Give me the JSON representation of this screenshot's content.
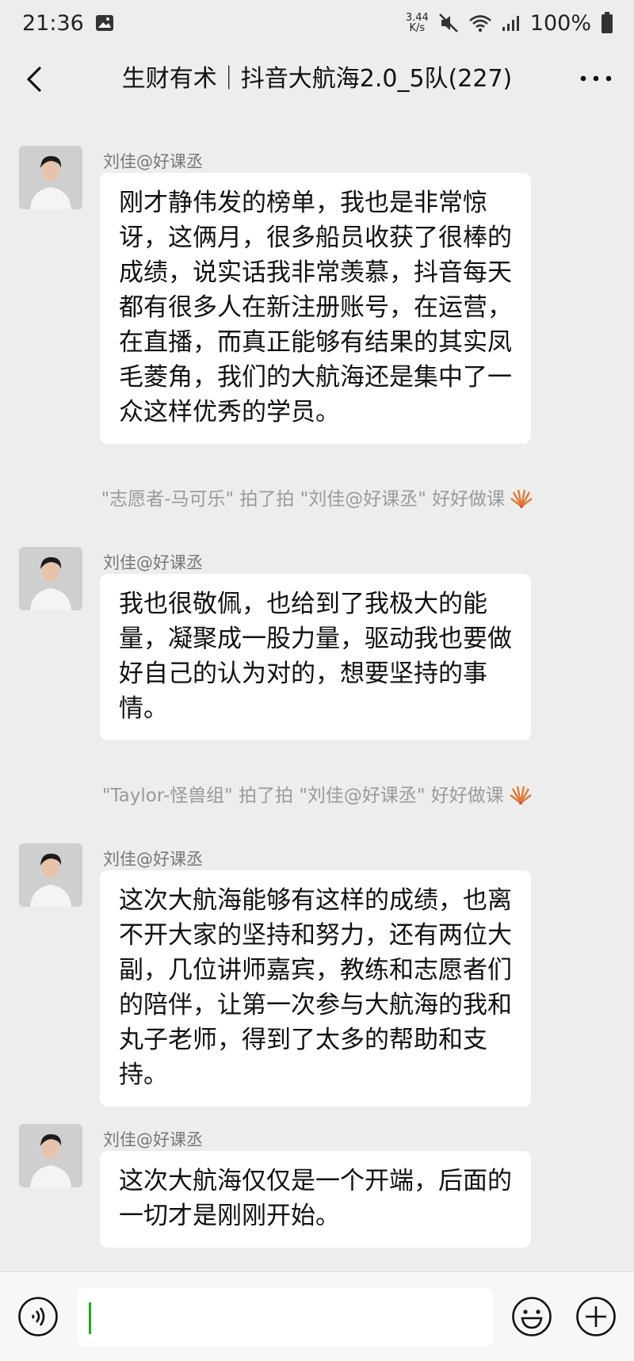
{
  "status": {
    "time": "21:36",
    "net_speed_value": "3.44",
    "net_speed_unit": "K/s",
    "battery": "100%",
    "icons": [
      "image-icon",
      "mute-icon",
      "wifi-icon",
      "signal-icon",
      "battery-icon"
    ]
  },
  "header": {
    "title": "生财有术｜抖音大航海2.0_5队(227)"
  },
  "messages": [
    {
      "sender": "刘佳@好课丞",
      "text": "刚才静伟发的榜单，我也是非常惊讶，这俩月，很多船员收获了很棒的成绩，说实话我非常羡慕，抖音每天都有很多人在新注册账号，在运营，在直播，而真正能够有结果的其实凤毛菱角，我们的大航海还是集中了一众这样优秀的学员。"
    },
    {
      "sender": "刘佳@好课丞",
      "text": "我也很敬佩，也给到了我极大的能量，凝聚成一股力量，驱动我也要做好自己的认为对的，想要坚持的事情。"
    },
    {
      "sender": "刘佳@好课丞",
      "text": "这次大航海能够有这样的成绩，也离不开大家的坚持和努力，还有两位大副，几位讲师嘉宾，教练和志愿者们的陪伴，让第一次参与大航海的我和丸子老师，得到了太多的帮助和支持。"
    },
    {
      "sender": "刘佳@好课丞",
      "text": "这次大航海仅仅是一个开端，后面的一切才是刚刚开始。"
    }
  ],
  "system_notices": [
    {
      "text": "\"志愿者-马可乐\" 拍了拍 \"刘佳@好课丞\" 好好做课"
    },
    {
      "text": "\"Taylor-怪兽组\" 拍了拍 \"刘佳@好课丞\" 好好做课"
    }
  ],
  "colors": {
    "background": "#ededed",
    "bubble": "#ffffff",
    "cursor": "#1aad19",
    "system_text": "#9a9a9a"
  }
}
